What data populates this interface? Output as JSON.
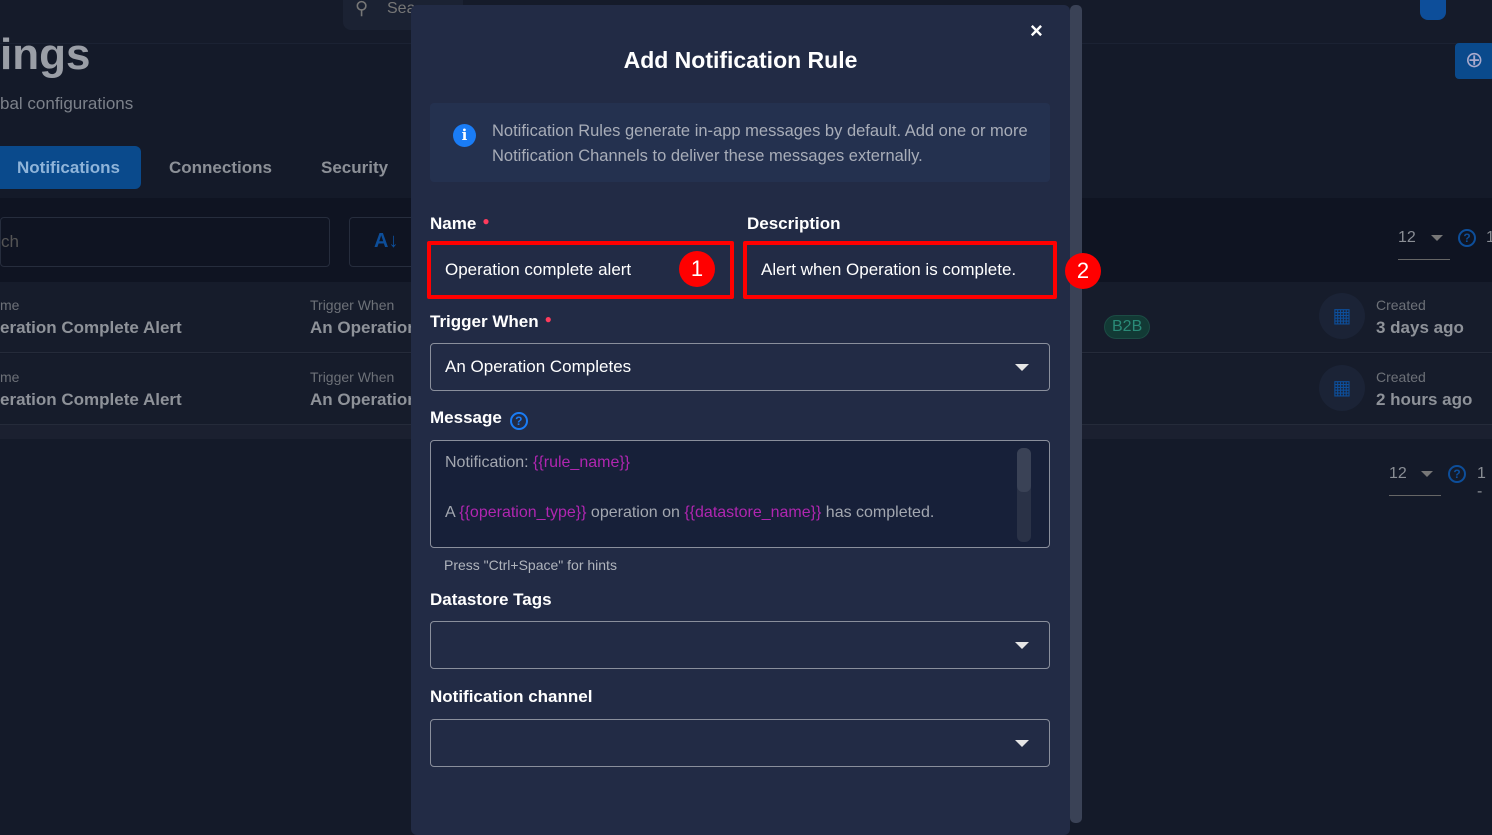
{
  "background": {
    "search_placeholder": "Sea",
    "page_title": "ings",
    "page_subtitle": "bal configurations",
    "tabs": [
      {
        "label": "Notifications",
        "active": true
      },
      {
        "label": "Connections"
      },
      {
        "label": "Security"
      }
    ],
    "filter_search_placeholder": "ch",
    "sort_icon": "sort-alpha-down-icon",
    "page_size": "12",
    "page_size_bottom": "12",
    "range_top": "1",
    "range_bottom": "1 -",
    "rows": [
      {
        "name_label": "me",
        "name": "eration Complete Alert",
        "trigger_label": "Trigger When",
        "trigger": "An Operation",
        "tag": "B2B",
        "created_label": "Created",
        "created": "3 days ago"
      },
      {
        "name_label": "me",
        "name": "eration Complete Alert",
        "trigger_label": "Trigger When",
        "trigger": "An Operation",
        "created_label": "Created",
        "created": "2 hours ago"
      }
    ]
  },
  "modal": {
    "title": "Add Notification Rule",
    "close_icon": "×",
    "info_text": "Notification Rules generate in-app messages by default. Add one or more Notification Channels to deliver these messages externally.",
    "name_label": "Name",
    "name_value": "Operation complete alert",
    "description_label": "Description",
    "description_value": "Alert when Operation is complete.",
    "trigger_label": "Trigger When",
    "trigger_value": "An Operation Completes",
    "message_label": "Message",
    "message": {
      "line1_text": "Notification: ",
      "line1_var": "{{rule_name}}",
      "line2_a": "A ",
      "line2_var1": "{{operation_type}}",
      "line2_b": " operation on ",
      "line2_var2": "{{datastore_name}}",
      "line2_c": " has completed."
    },
    "hint": "Press \"Ctrl+Space\" for hints",
    "tags_label": "Datastore Tags",
    "channel_label": "Notification channel"
  },
  "annotations": {
    "step1": "1",
    "step2": "2",
    "color": "#ff0000"
  }
}
